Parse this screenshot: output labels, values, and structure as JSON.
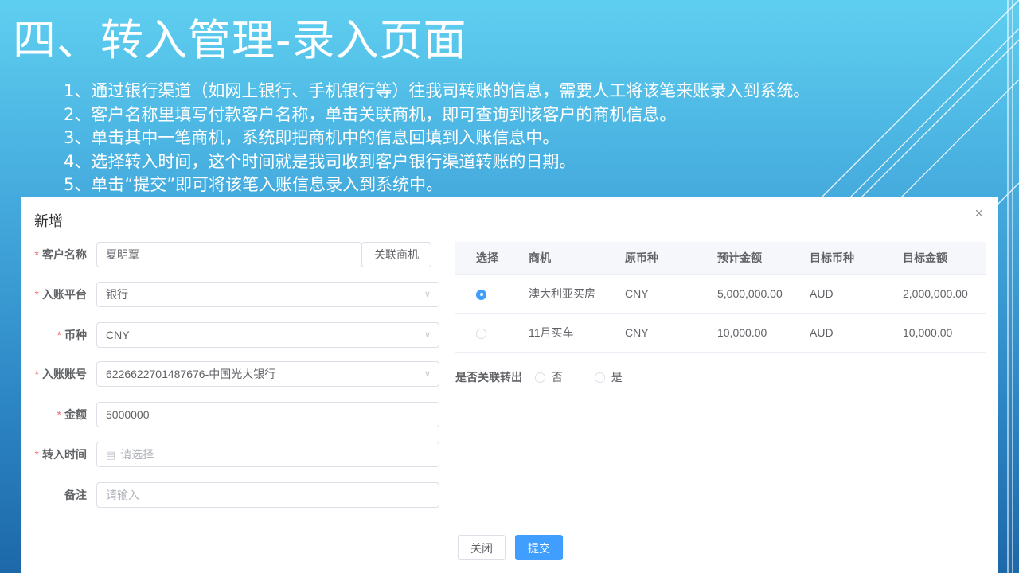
{
  "slide": {
    "title": "四、转入管理-录入页面",
    "bullets": [
      "1、通过银行渠道（如网上银行、手机银行等）往我司转账的信息，需要人工将该笔来账录入到系统。",
      "2、客户名称里填写付款客户名称，单击关联商机，即可查询到该客户的商机信息。",
      "3、单击其中一笔商机，系统即把商机中的信息回填到入账信息中。",
      "4、选择转入时间，这个时间就是我司收到客户银行渠道转账的日期。",
      "5、单击“提交”即可将该笔入账信息录入到系统中。"
    ]
  },
  "dialog": {
    "title": "新增",
    "close_glyph": "×",
    "form": {
      "customer": {
        "label": "客户名称",
        "value": "夏明覃",
        "button": "关联商机"
      },
      "platform": {
        "label": "入账平台",
        "value": "银行"
      },
      "currency": {
        "label": "币种",
        "value": "CNY"
      },
      "account": {
        "label": "入账账号",
        "value": "6226622701487676-中国光大银行"
      },
      "amount": {
        "label": "金额",
        "value": "5000000"
      },
      "time": {
        "label": "转入时间",
        "placeholder": "请选择"
      },
      "remark": {
        "label": "备注",
        "placeholder": "请输入"
      },
      "required_mark": "*"
    },
    "table": {
      "headers": [
        "选择",
        "商机",
        "原币种",
        "预计金额",
        "目标币种",
        "目标金额"
      ],
      "rows": [
        {
          "selected": true,
          "opportunity": "澳大利亚买房",
          "src_currency": "CNY",
          "expected": "5,000,000.00",
          "target_currency": "AUD",
          "target_amount": "2,000,000.00"
        },
        {
          "selected": false,
          "opportunity": "11月买车",
          "src_currency": "CNY",
          "expected": "10,000.00",
          "target_currency": "AUD",
          "target_amount": "10,000.00"
        }
      ]
    },
    "link_transfer": {
      "label": "是否关联转出",
      "options": [
        "否",
        "是"
      ]
    },
    "buttons": {
      "close": "关闭",
      "submit": "提交"
    }
  },
  "colors": {
    "primary": "#409eff",
    "required": "#f56c6c",
    "bg_top": "#5fcff0",
    "bg_bottom": "#1d68a8"
  }
}
